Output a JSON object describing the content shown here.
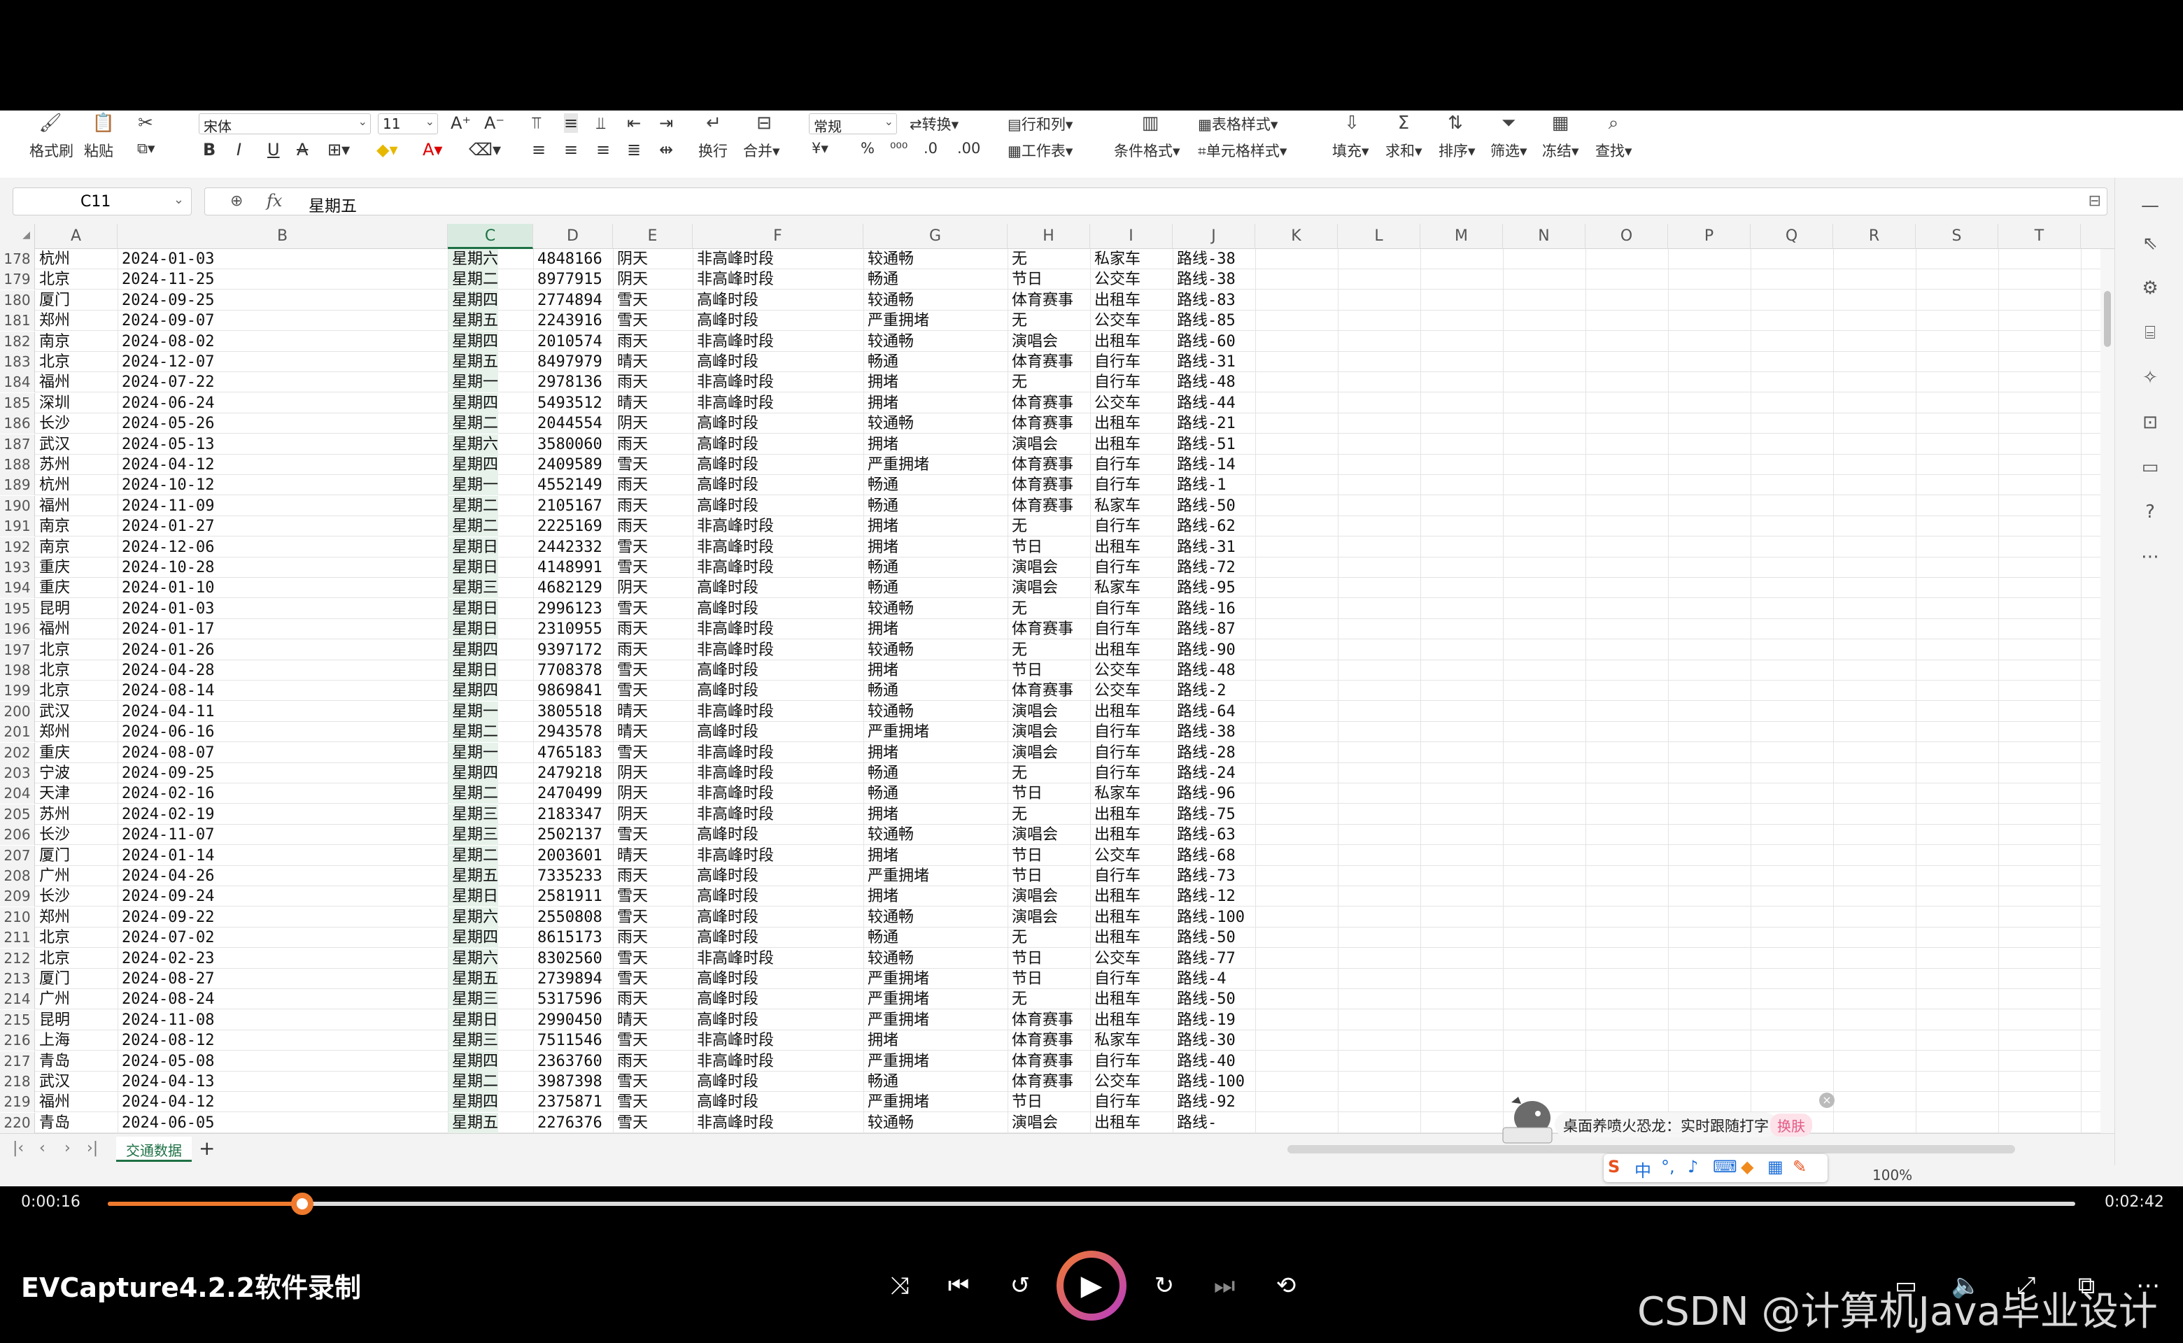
{
  "ribbon": {
    "format_painter": "格式刷",
    "paste": "粘贴",
    "font_name": "宋体",
    "font_size": "11",
    "wrap": "换行",
    "merge": "合并",
    "number_format": "常规",
    "convert": "转换",
    "rows_cols": "行和列",
    "worksheet": "工作表",
    "conditional_format": "条件格式",
    "table_style": "表格样式",
    "cell_style": "单元格样式",
    "fill": "填充",
    "sum": "求和",
    "sort": "排序",
    "filter": "筛选",
    "freeze": "冻结",
    "find": "查找"
  },
  "formula_bar": {
    "cell_ref": "C11",
    "fx": "fx",
    "value": "星期五"
  },
  "columns": [
    "A",
    "B",
    "C",
    "D",
    "E",
    "F",
    "G",
    "H",
    "I",
    "J",
    "K",
    "L",
    "M",
    "N",
    "O",
    "P",
    "Q",
    "R",
    "S",
    "T"
  ],
  "selected_column": "C",
  "rows": [
    [
      "178",
      "杭州",
      "2024-01-03",
      "星期六",
      "4848166",
      "阴天",
      "非高峰时段",
      "较通畅",
      "无",
      "私家车",
      "路线-38"
    ],
    [
      "179",
      "北京",
      "2024-11-25",
      "星期二",
      "8977915",
      "阴天",
      "非高峰时段",
      "畅通",
      "节日",
      "公交车",
      "路线-38"
    ],
    [
      "180",
      "厦门",
      "2024-09-25",
      "星期四",
      "2774894",
      "雪天",
      "高峰时段",
      "较通畅",
      "体育赛事",
      "出租车",
      "路线-83"
    ],
    [
      "181",
      "郑州",
      "2024-09-07",
      "星期五",
      "2243916",
      "雪天",
      "高峰时段",
      "严重拥堵",
      "无",
      "公交车",
      "路线-85"
    ],
    [
      "182",
      "南京",
      "2024-08-02",
      "星期四",
      "2010574",
      "雨天",
      "非高峰时段",
      "较通畅",
      "演唱会",
      "出租车",
      "路线-60"
    ],
    [
      "183",
      "北京",
      "2024-12-07",
      "星期五",
      "8497979",
      "晴天",
      "高峰时段",
      "畅通",
      "体育赛事",
      "自行车",
      "路线-31"
    ],
    [
      "184",
      "福州",
      "2024-07-22",
      "星期一",
      "2978136",
      "雨天",
      "非高峰时段",
      "拥堵",
      "无",
      "自行车",
      "路线-48"
    ],
    [
      "185",
      "深圳",
      "2024-06-24",
      "星期四",
      "5493512",
      "晴天",
      "非高峰时段",
      "拥堵",
      "体育赛事",
      "公交车",
      "路线-44"
    ],
    [
      "186",
      "长沙",
      "2024-05-26",
      "星期二",
      "2044554",
      "阴天",
      "高峰时段",
      "较通畅",
      "体育赛事",
      "出租车",
      "路线-21"
    ],
    [
      "187",
      "武汉",
      "2024-05-13",
      "星期六",
      "3580060",
      "雨天",
      "高峰时段",
      "拥堵",
      "演唱会",
      "出租车",
      "路线-51"
    ],
    [
      "188",
      "苏州",
      "2024-04-12",
      "星期四",
      "2409589",
      "雪天",
      "高峰时段",
      "严重拥堵",
      "体育赛事",
      "自行车",
      "路线-14"
    ],
    [
      "189",
      "杭州",
      "2024-10-12",
      "星期一",
      "4552149",
      "雨天",
      "高峰时段",
      "畅通",
      "体育赛事",
      "自行车",
      "路线-1"
    ],
    [
      "190",
      "福州",
      "2024-11-09",
      "星期二",
      "2105167",
      "雨天",
      "高峰时段",
      "畅通",
      "体育赛事",
      "私家车",
      "路线-50"
    ],
    [
      "191",
      "南京",
      "2024-01-27",
      "星期二",
      "2225169",
      "雨天",
      "非高峰时段",
      "拥堵",
      "无",
      "自行车",
      "路线-62"
    ],
    [
      "192",
      "南京",
      "2024-12-06",
      "星期日",
      "2442332",
      "雪天",
      "非高峰时段",
      "拥堵",
      "节日",
      "出租车",
      "路线-31"
    ],
    [
      "193",
      "重庆",
      "2024-10-28",
      "星期日",
      "4148991",
      "雪天",
      "非高峰时段",
      "畅通",
      "演唱会",
      "自行车",
      "路线-72"
    ],
    [
      "194",
      "重庆",
      "2024-01-10",
      "星期三",
      "4682129",
      "阴天",
      "高峰时段",
      "畅通",
      "演唱会",
      "私家车",
      "路线-95"
    ],
    [
      "195",
      "昆明",
      "2024-01-03",
      "星期日",
      "2996123",
      "雪天",
      "高峰时段",
      "较通畅",
      "无",
      "自行车",
      "路线-16"
    ],
    [
      "196",
      "福州",
      "2024-01-17",
      "星期日",
      "2310955",
      "雨天",
      "非高峰时段",
      "拥堵",
      "体育赛事",
      "自行车",
      "路线-87"
    ],
    [
      "197",
      "北京",
      "2024-01-26",
      "星期四",
      "9397172",
      "雨天",
      "非高峰时段",
      "较通畅",
      "无",
      "出租车",
      "路线-90"
    ],
    [
      "198",
      "北京",
      "2024-04-28",
      "星期日",
      "7708378",
      "雪天",
      "高峰时段",
      "拥堵",
      "节日",
      "公交车",
      "路线-48"
    ],
    [
      "199",
      "北京",
      "2024-08-14",
      "星期四",
      "9869841",
      "雪天",
      "高峰时段",
      "畅通",
      "体育赛事",
      "公交车",
      "路线-2"
    ],
    [
      "200",
      "武汉",
      "2024-04-11",
      "星期一",
      "3805518",
      "晴天",
      "非高峰时段",
      "较通畅",
      "演唱会",
      "出租车",
      "路线-64"
    ],
    [
      "201",
      "郑州",
      "2024-06-16",
      "星期二",
      "2943578",
      "晴天",
      "高峰时段",
      "严重拥堵",
      "演唱会",
      "自行车",
      "路线-38"
    ],
    [
      "202",
      "重庆",
      "2024-08-07",
      "星期一",
      "4765183",
      "雪天",
      "非高峰时段",
      "拥堵",
      "演唱会",
      "自行车",
      "路线-28"
    ],
    [
      "203",
      "宁波",
      "2024-09-25",
      "星期四",
      "2479218",
      "阴天",
      "非高峰时段",
      "畅通",
      "无",
      "自行车",
      "路线-24"
    ],
    [
      "204",
      "天津",
      "2024-02-16",
      "星期二",
      "2470499",
      "阴天",
      "非高峰时段",
      "畅通",
      "节日",
      "私家车",
      "路线-96"
    ],
    [
      "205",
      "苏州",
      "2024-02-19",
      "星期三",
      "2183347",
      "阴天",
      "非高峰时段",
      "拥堵",
      "无",
      "出租车",
      "路线-75"
    ],
    [
      "206",
      "长沙",
      "2024-11-07",
      "星期三",
      "2502137",
      "雪天",
      "高峰时段",
      "较通畅",
      "演唱会",
      "出租车",
      "路线-63"
    ],
    [
      "207",
      "厦门",
      "2024-01-14",
      "星期二",
      "2003601",
      "晴天",
      "非高峰时段",
      "拥堵",
      "节日",
      "公交车",
      "路线-68"
    ],
    [
      "208",
      "广州",
      "2024-04-26",
      "星期五",
      "7335233",
      "雨天",
      "高峰时段",
      "严重拥堵",
      "节日",
      "自行车",
      "路线-73"
    ],
    [
      "209",
      "长沙",
      "2024-09-24",
      "星期日",
      "2581911",
      "雪天",
      "高峰时段",
      "拥堵",
      "演唱会",
      "出租车",
      "路线-12"
    ],
    [
      "210",
      "郑州",
      "2024-09-22",
      "星期六",
      "2550808",
      "雪天",
      "高峰时段",
      "较通畅",
      "演唱会",
      "出租车",
      "路线-100"
    ],
    [
      "211",
      "北京",
      "2024-07-02",
      "星期四",
      "8615173",
      "雨天",
      "高峰时段",
      "畅通",
      "无",
      "出租车",
      "路线-50"
    ],
    [
      "212",
      "北京",
      "2024-02-23",
      "星期六",
      "8302560",
      "雪天",
      "非高峰时段",
      "较通畅",
      "节日",
      "公交车",
      "路线-77"
    ],
    [
      "213",
      "厦门",
      "2024-08-27",
      "星期五",
      "2739894",
      "雪天",
      "高峰时段",
      "严重拥堵",
      "节日",
      "自行车",
      "路线-4"
    ],
    [
      "214",
      "广州",
      "2024-08-24",
      "星期三",
      "5317596",
      "雨天",
      "高峰时段",
      "严重拥堵",
      "无",
      "出租车",
      "路线-50"
    ],
    [
      "215",
      "昆明",
      "2024-11-08",
      "星期日",
      "2990450",
      "晴天",
      "高峰时段",
      "严重拥堵",
      "体育赛事",
      "出租车",
      "路线-19"
    ],
    [
      "216",
      "上海",
      "2024-08-12",
      "星期三",
      "7511546",
      "雪天",
      "非高峰时段",
      "拥堵",
      "体育赛事",
      "私家车",
      "路线-30"
    ],
    [
      "217",
      "青岛",
      "2024-05-08",
      "星期四",
      "2363760",
      "雨天",
      "非高峰时段",
      "严重拥堵",
      "体育赛事",
      "自行车",
      "路线-40"
    ],
    [
      "218",
      "武汉",
      "2024-04-13",
      "星期二",
      "3987398",
      "雪天",
      "高峰时段",
      "畅通",
      "体育赛事",
      "公交车",
      "路线-100"
    ],
    [
      "219",
      "福州",
      "2024-04-12",
      "星期四",
      "2375871",
      "雪天",
      "高峰时段",
      "严重拥堵",
      "节日",
      "自行车",
      "路线-92"
    ],
    [
      "220",
      "青岛",
      "2024-06-05",
      "星期五",
      "2276376",
      "雪天",
      "非高峰时段",
      "较通畅",
      "演唱会",
      "出租车",
      "路线-"
    ]
  ],
  "sheet_tabs": [
    "交通数据"
  ],
  "status": {
    "zoom": "100%"
  },
  "widget": {
    "text": "桌面养喷火恐龙：实时跟随打字",
    "skin_button": "换肤"
  },
  "ime": {
    "mode": "中"
  },
  "player": {
    "elapsed": "0:00:16",
    "total": "0:02:42",
    "progress": 0.099,
    "title": "EVCapture4.2.2软件录制",
    "accent": "#ef7a2d"
  },
  "watermark": "CSDN @计算机Java毕业设计"
}
